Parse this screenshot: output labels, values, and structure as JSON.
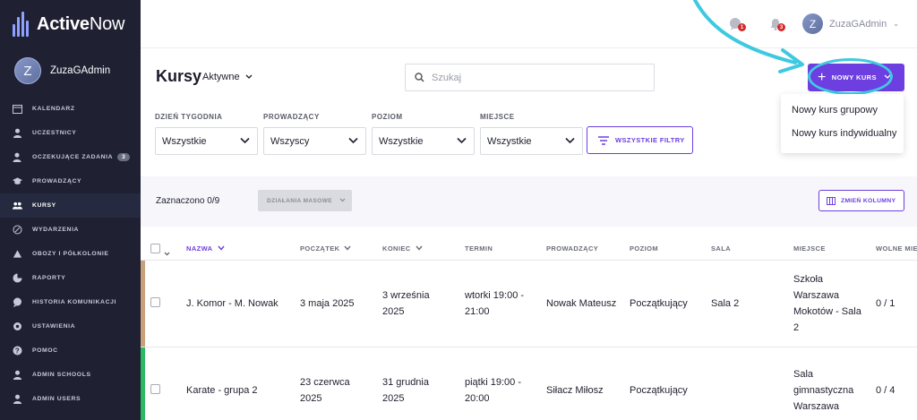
{
  "app": {
    "logo_bold": "Active",
    "logo_light": "Now"
  },
  "sidebar": {
    "user": {
      "initial": "Z",
      "name": "ZuzaGAdmin"
    },
    "items": [
      {
        "label": "KALENDARZ",
        "icon": "calendar-icon"
      },
      {
        "label": "UCZESTNICY",
        "icon": "person-icon"
      },
      {
        "label": "OCZEKUJĄCE ZADANIA",
        "icon": "task-person-icon",
        "badge": "3"
      },
      {
        "label": "PROWADZĄCY",
        "icon": "graduation-cap-icon"
      },
      {
        "label": "KURSY",
        "icon": "group-icon",
        "active": true
      },
      {
        "label": "WYDARZENIA",
        "icon": "event-icon"
      },
      {
        "label": "OBOZY I PÓŁKOLONIE",
        "icon": "tent-icon"
      },
      {
        "label": "RAPORTY",
        "icon": "chart-icon"
      },
      {
        "label": "HISTORIA KOMUNIKACJI",
        "icon": "chat-icon"
      },
      {
        "label": "USTAWIENIA",
        "icon": "gear-icon"
      },
      {
        "label": "POMOC",
        "icon": "help-icon"
      },
      {
        "label": "ADMIN SCHOOLS",
        "icon": "person-icon"
      },
      {
        "label": "ADMIN USERS",
        "icon": "person-icon"
      }
    ]
  },
  "topbar": {
    "messages_badge": "1",
    "notifications_badge": "3",
    "user": {
      "initial": "Z",
      "name": "ZuzaGAdmin"
    }
  },
  "header": {
    "title": "Kursy",
    "status": "Aktywne",
    "search_placeholder": "Szukaj",
    "new_button_label": "NOWY KURS",
    "dropdown": [
      "Nowy kurs grupowy",
      "Nowy kurs indywidualny"
    ]
  },
  "filters": [
    {
      "label": "DZIEŃ TYGODNIA",
      "value": "Wszystkie"
    },
    {
      "label": "PROWADZĄCY",
      "value": "Wszyscy"
    },
    {
      "label": "POZIOM",
      "value": "Wszystkie"
    },
    {
      "label": "MIEJSCE",
      "value": "Wszystkie"
    }
  ],
  "all_filters_label": "WSZYSTKIE FILTRY",
  "selection": {
    "count_label": "Zaznaczono 0/9",
    "mass_actions_label": "DZIAŁANIA MASOWE",
    "columns_label": "ZMIEŃ KOLUMNY"
  },
  "table": {
    "columns": [
      "NAZWA",
      "POCZĄTEK",
      "KONIEC",
      "TERMIN",
      "PROWADZĄCY",
      "POZIOM",
      "SALA",
      "MIEJSCE",
      "WOLNE MIE"
    ],
    "rows": [
      {
        "strip_color": "#c8a07c",
        "name": "J. Komor - M. Nowak",
        "start": "3 maja 2025",
        "end": [
          "3 września",
          "2025"
        ],
        "term": [
          "wtorki 19:00 -",
          "21:00"
        ],
        "instructor": "Nowak Mateusz",
        "level": "Początkujący",
        "room": "Sala 2",
        "place": [
          "Szkoła",
          "Warszawa",
          "Mokotów - Sala",
          "2"
        ],
        "free": "0 / 1"
      },
      {
        "strip_color": "#2fb864",
        "name": "Karate - grupa 2",
        "start": [
          "23 czerwca",
          "2025"
        ],
        "end": [
          "31 grudnia",
          "2025"
        ],
        "term": [
          "piątki 19:00 -",
          "20:00"
        ],
        "instructor": "Siłacz Miłosz",
        "level": "Początkujący",
        "room": "",
        "place": [
          "Sala",
          "gimnastyczna",
          "Warszawa"
        ],
        "free": "0 / 4"
      }
    ]
  },
  "colors": {
    "accent": "#6d3ee0",
    "sidebar": "#1f2133",
    "annotation": "#3fc9e0"
  }
}
